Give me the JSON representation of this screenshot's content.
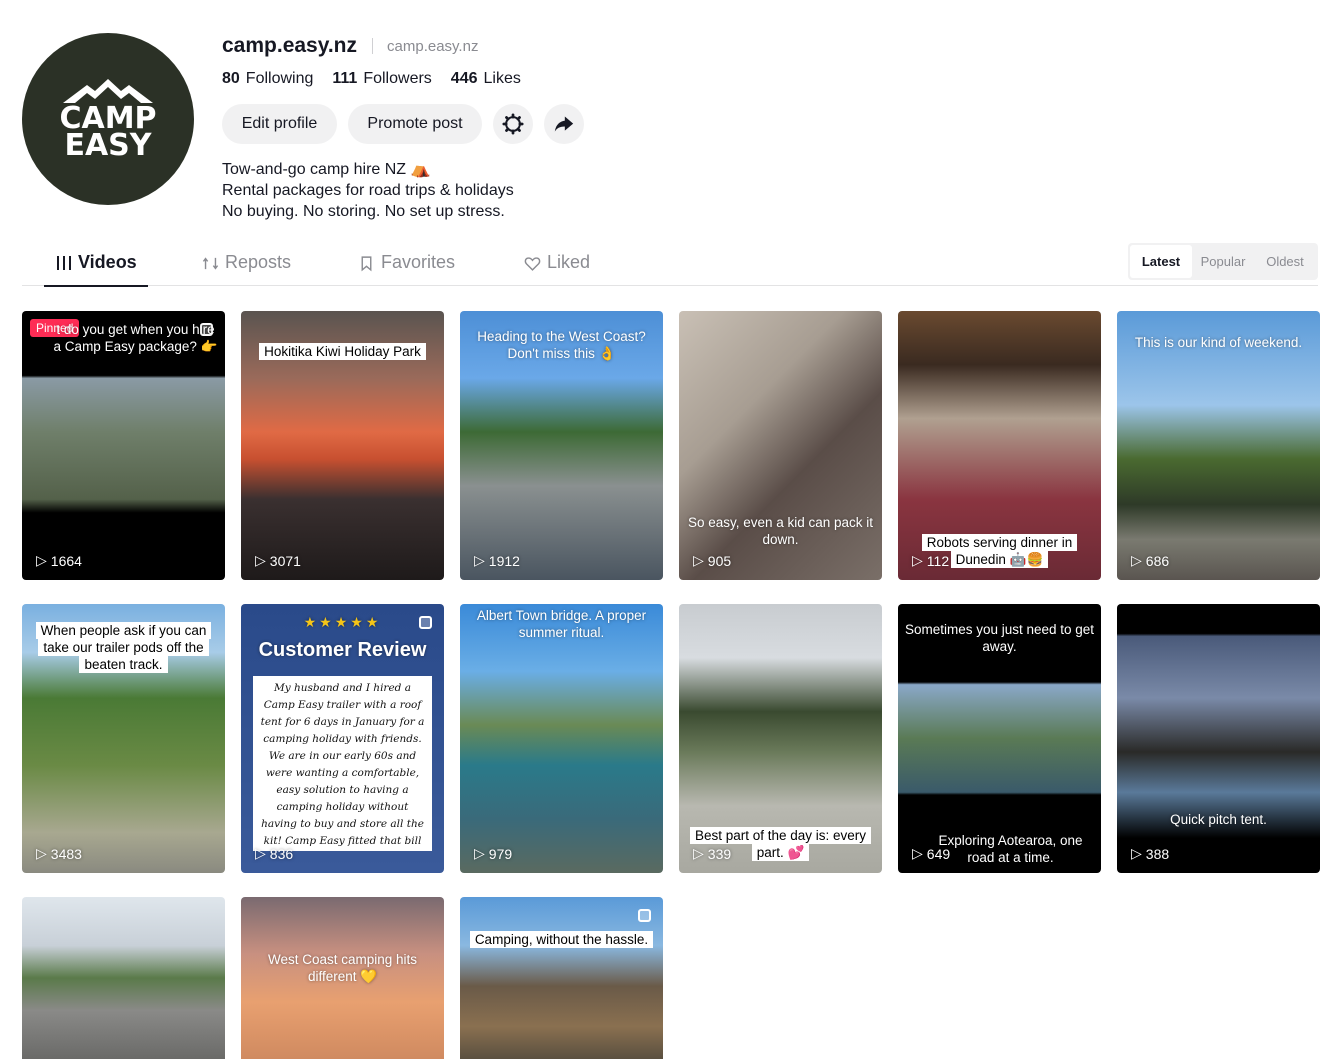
{
  "profile": {
    "avatar_text": "CAMP EASY",
    "username": "camp.easy.nz",
    "nickname": "camp.easy.nz",
    "following_count": "80",
    "following_label": "Following",
    "followers_count": "111",
    "followers_label": "Followers",
    "likes_count": "446",
    "likes_label": "Likes",
    "bio": [
      "Tow-and-go camp hire NZ ⛺",
      "Rental packages for road trips & holidays",
      "No buying. No storing. No set up stress."
    ]
  },
  "actions": {
    "edit_label": "Edit profile",
    "promote_label": "Promote post",
    "settings_icon": "gear-icon",
    "share_icon": "share-arrow-icon"
  },
  "tabs": [
    {
      "label": "Videos",
      "icon": "grid-bars-icon",
      "active": true
    },
    {
      "label": "Reposts",
      "icon": "repost-icon",
      "active": false
    },
    {
      "label": "Favorites",
      "icon": "bookmark-icon",
      "active": false
    },
    {
      "label": "Liked",
      "icon": "heart-icon",
      "active": false
    }
  ],
  "sort": {
    "options": [
      "Latest",
      "Popular",
      "Oldest"
    ],
    "selected": "Latest"
  },
  "videos": [
    {
      "caption": "t do you get when you hire a Camp Easy package? 👉",
      "views": "1664",
      "pinned": "Pinned",
      "multi": true
    },
    {
      "caption": "Hokitika Kiwi Holiday Park",
      "views": "3071"
    },
    {
      "caption": "Heading to the West Coast? Don't miss this 👌",
      "views": "1912"
    },
    {
      "caption": "So easy, even a kid can pack it down.",
      "views": "905"
    },
    {
      "caption": "Robots serving dinner in Dunedin 🤖🍔",
      "views": "112"
    },
    {
      "caption": "This is our kind of weekend.",
      "views": "686"
    },
    {
      "caption": "When people ask if you can take our trailer pods off the beaten track.",
      "views": "3483"
    },
    {
      "caption": "Customer Review",
      "views": "836",
      "multi": true,
      "stars": "★★★★★",
      "review": "My husband and I hired a Camp Easy trailer with a roof tent for 6 days in January for a camping holiday with friends. We are in our early 60s and were wanting a comfortable, easy solution to having a camping holiday without having to buy and store all the kit! Camp Easy fitted that bill and did not disappoint."
    },
    {
      "caption": "Albert Town bridge. A proper summer ritual.",
      "views": "979"
    },
    {
      "caption": "Best part of the day is: every part. 💕",
      "views": "339"
    },
    {
      "caption": "Sometimes you just need to get away.",
      "caption2": "Exploring Aotearoa, one road at a time.",
      "views": "649"
    },
    {
      "caption": "Quick pitch tent.",
      "views": "388"
    },
    {
      "caption": "",
      "views": ""
    },
    {
      "caption": "West Coast camping hits different 💛",
      "views": ""
    },
    {
      "caption": "Camping, without the hassle.",
      "views": "",
      "multi": true
    }
  ]
}
